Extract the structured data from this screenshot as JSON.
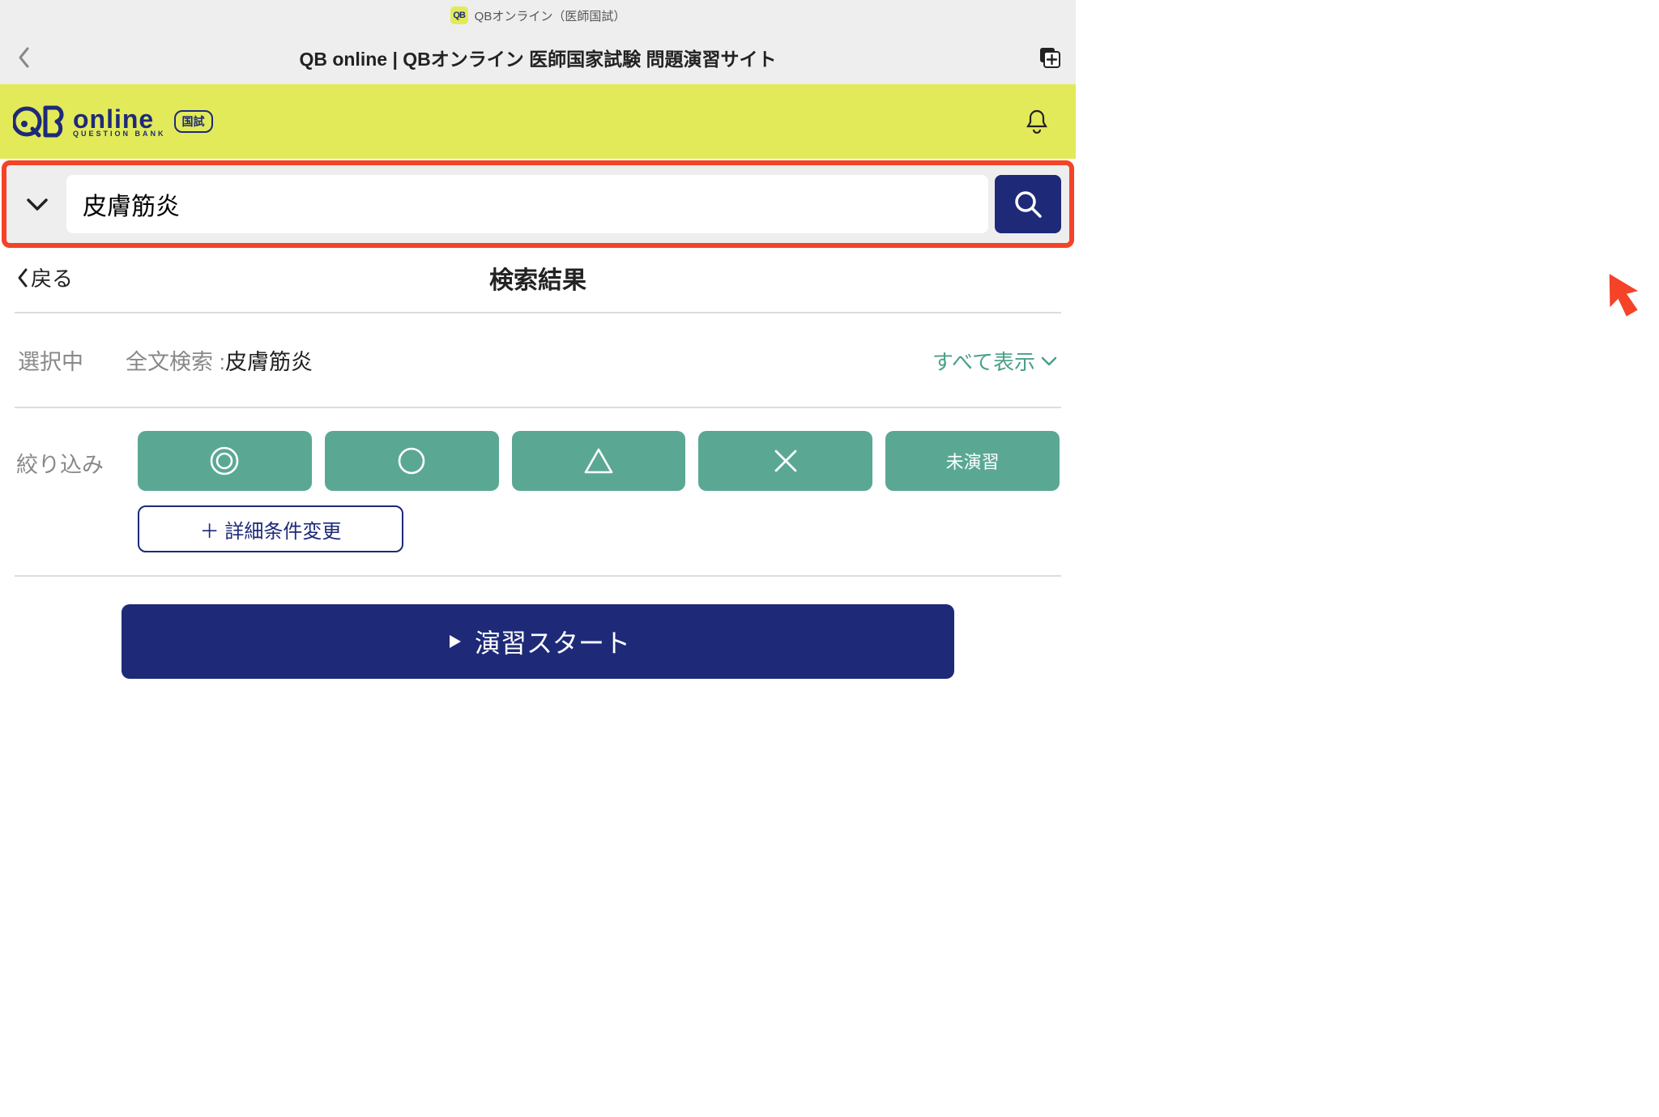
{
  "status": {
    "app_name": "QBオンライン（医師国試）",
    "app_icon_text": "QB"
  },
  "navbar": {
    "title": "QB online | QBオンライン 医師国家試験 問題演習サイト"
  },
  "brand": {
    "logo_main": "QB",
    "logo_online": "online",
    "logo_sub": "QUESTION BANK",
    "logo_badge": "国試"
  },
  "search": {
    "value": "皮膚筋炎"
  },
  "page": {
    "back": "戻る",
    "title": "検索結果"
  },
  "selection": {
    "label": "選択中",
    "prefix": "全文検索 : ",
    "term": "皮膚筋炎",
    "show_all": "すべて表示"
  },
  "filter": {
    "label": "絞り込み",
    "buttons": [
      "◎",
      "○",
      "△",
      "×",
      "未演習"
    ],
    "detail_change": "＋ 詳細条件変更"
  },
  "start": {
    "label": "演習スタート"
  }
}
